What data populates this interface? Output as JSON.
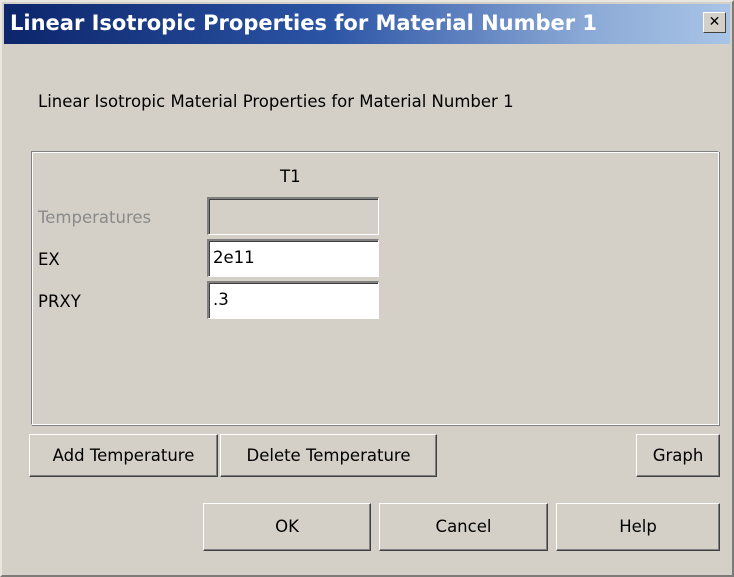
{
  "window": {
    "title": "Linear Isotropic Properties for Material Number 1",
    "close_glyph": "✕"
  },
  "heading": "Linear Isotropic Material Properties for Material Number 1",
  "table": {
    "column_header": "T1",
    "rows": [
      {
        "label": "Temperatures",
        "value": "",
        "enabled": false
      },
      {
        "label": "EX",
        "value": "2e11",
        "enabled": true
      },
      {
        "label": "PRXY",
        "value": ".3",
        "enabled": true
      }
    ]
  },
  "buttons": {
    "add_temperature": "Add Temperature",
    "delete_temperature": "Delete Temperature",
    "graph": "Graph",
    "ok": "OK",
    "cancel": "Cancel",
    "help": "Help"
  }
}
